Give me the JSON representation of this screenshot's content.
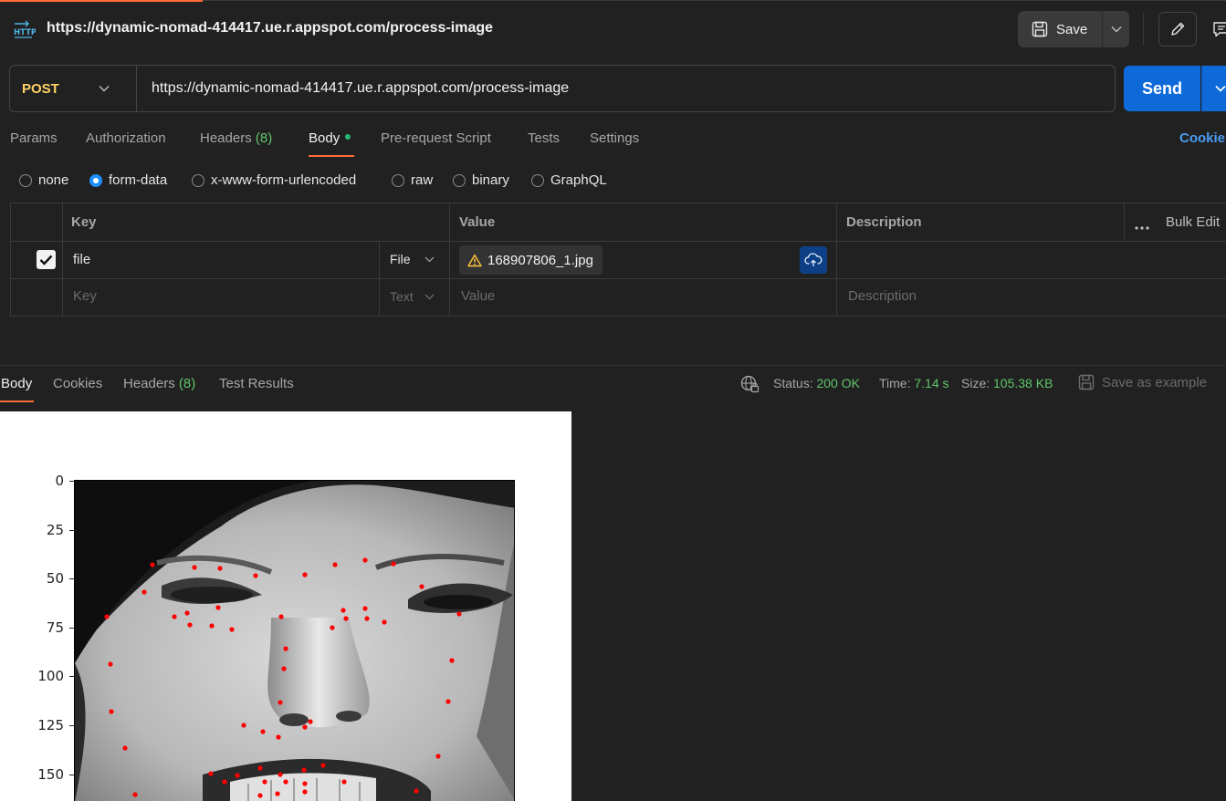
{
  "header": {
    "icon": "http-icon",
    "title": "https://dynamic-nomad-414417.ue.r.appspot.com/process-image",
    "save_label": "Save"
  },
  "request": {
    "method": "POST",
    "url": "https://dynamic-nomad-414417.ue.r.appspot.com/process-image",
    "send_label": "Send"
  },
  "tabs": {
    "params": "Params",
    "authorization": "Authorization",
    "headers": "Headers",
    "headers_count": "(8)",
    "body": "Body",
    "prerequest": "Pre-request Script",
    "tests": "Tests",
    "settings": "Settings",
    "cookies": "Cookie"
  },
  "body_modes": {
    "none": "none",
    "form_data": "form-data",
    "urlencoded": "x-www-form-urlencoded",
    "raw": "raw",
    "binary": "binary",
    "graphql": "GraphQL",
    "selected": "form-data"
  },
  "table": {
    "headers": {
      "key": "Key",
      "value": "Value",
      "description": "Description",
      "bulk_edit": "Bulk Edit"
    },
    "rows": [
      {
        "checked": true,
        "key": "file",
        "type": "File",
        "value": "168907806_1.jpg",
        "description": ""
      }
    ],
    "placeholder": {
      "key": "Key",
      "type": "Text",
      "value": "Value",
      "description": "Description"
    }
  },
  "response": {
    "tabs": {
      "body": "Body",
      "cookies": "Cookies",
      "headers": "Headers",
      "headers_count": "(8)",
      "test_results": "Test Results"
    },
    "status_label": "Status:",
    "status_value": "200 OK",
    "time_label": "Time:",
    "time_value": "7.14 s",
    "size_label": "Size:",
    "size_value": "105.38 KB",
    "save_example": "Save as example"
  },
  "plot": {
    "y_ticks": [
      "0",
      "25",
      "50",
      "75",
      "100",
      "125",
      "150"
    ],
    "marker_color": "#ff0000"
  },
  "colors": {
    "accent": "#ff6c37",
    "send": "#0f6ad9",
    "method": "#ffd264",
    "success": "#60c56a"
  }
}
